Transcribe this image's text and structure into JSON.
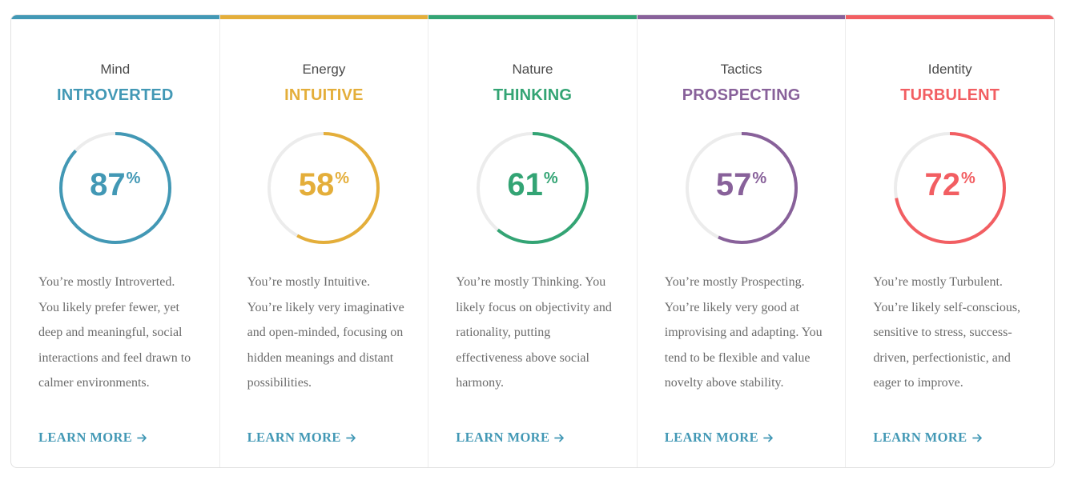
{
  "traits": [
    {
      "label": "Mind",
      "type": "INTROVERTED",
      "percent": 87,
      "percent_sign": "%",
      "color": "#4298b5",
      "description": "You’re mostly Introverted. You likely prefer fewer, yet deep and meaningful, social interactions and feel drawn to calmer environments.",
      "link": "LEARN MORE"
    },
    {
      "label": "Energy",
      "type": "INTUITIVE",
      "percent": 58,
      "percent_sign": "%",
      "color": "#e4ae3a",
      "description": "You’re mostly Intuitive. You’re likely very imaginative and open-minded, focusing on hidden meanings and distant possibilities.",
      "link": "LEARN MORE"
    },
    {
      "label": "Nature",
      "type": "THINKING",
      "percent": 61,
      "percent_sign": "%",
      "color": "#33a474",
      "description": "You’re mostly Thinking. You likely focus on objectivity and rationality, putting effectiveness above social harmony.",
      "link": "LEARN MORE"
    },
    {
      "label": "Tactics",
      "type": "PROSPECTING",
      "percent": 57,
      "percent_sign": "%",
      "color": "#88619a",
      "description": "You’re mostly Prospecting. You’re likely very good at improvising and adapting. You tend to be flexible and value novelty above stability.",
      "link": "LEARN MORE"
    },
    {
      "label": "Identity",
      "type": "TURBULENT",
      "percent": 72,
      "percent_sign": "%",
      "color": "#f25e62",
      "description": "You’re mostly Turbulent. You’re likely self-conscious, sensitive to stress, success-driven, perfectionistic, and eager to improve.",
      "link": "LEARN MORE"
    }
  ],
  "link_color": "#4298b5",
  "ring_track_color": "#ececec",
  "link_icon": "arrow-right-icon"
}
